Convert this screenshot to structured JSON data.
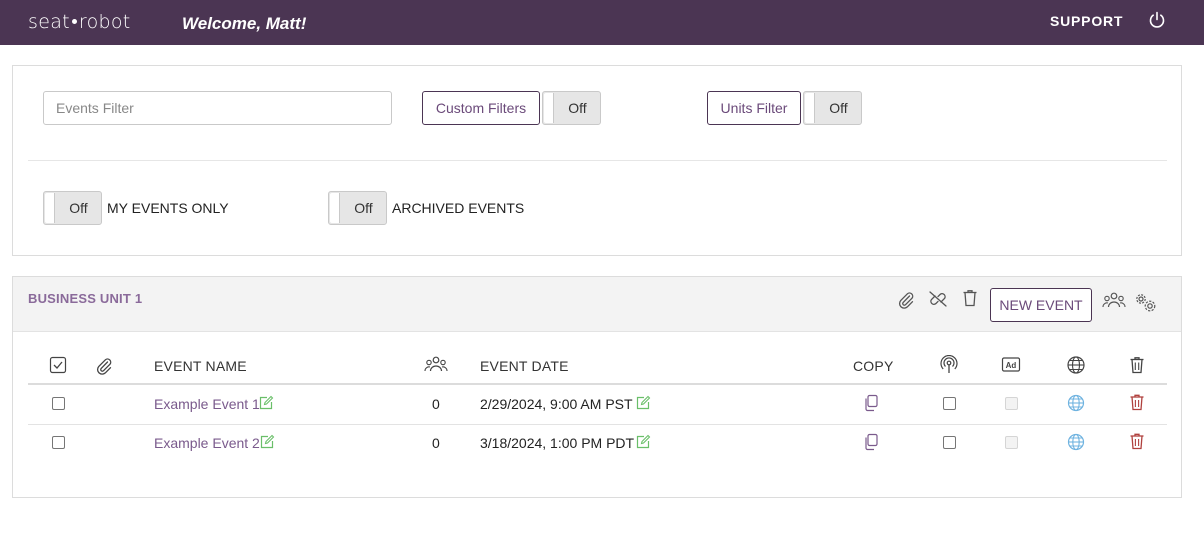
{
  "header": {
    "logo_left": "seat",
    "logo_right": "robot",
    "welcome": "Welcome, Matt!",
    "support": "SUPPORT"
  },
  "filters": {
    "events_filter_placeholder": "Events Filter",
    "custom_filters_label": "Custom Filters",
    "custom_filters_toggle": "Off",
    "units_filter_label": "Units Filter",
    "units_filter_toggle": "Off",
    "my_events_toggle": "Off",
    "my_events_label": "MY EVENTS ONLY",
    "archived_toggle": "Off",
    "archived_label": "ARCHIVED EVENTS"
  },
  "business_unit": {
    "title": "BUSINESS UNIT 1",
    "new_event_label": "NEW EVENT"
  },
  "table": {
    "columns": {
      "event_name": "EVENT NAME",
      "event_date": "EVENT DATE",
      "copy": "COPY"
    },
    "rows": [
      {
        "name": "Example Event 1",
        "count": "0",
        "date": "2/29/2024, 9:00 AM PST"
      },
      {
        "name": "Example Event 2",
        "count": "0",
        "date": "3/18/2024, 1:00 PM PDT"
      }
    ]
  },
  "colors": {
    "topbar": "#4b3553",
    "accent": "#7a5a8c",
    "edit_icon": "#6abf69",
    "globe_icon": "#6fb3e0",
    "trash_icon": "#b0413e"
  }
}
